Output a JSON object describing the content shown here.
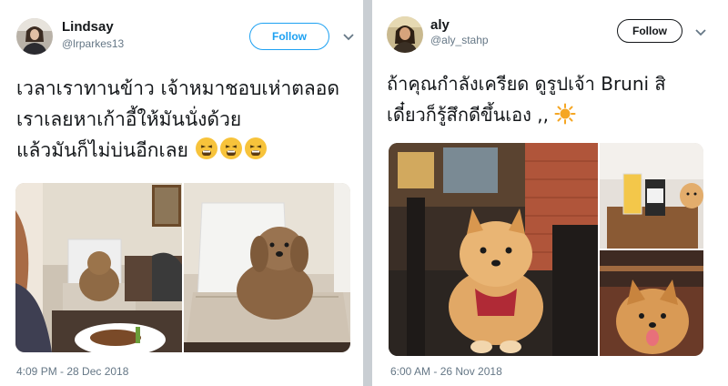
{
  "tweets": [
    {
      "author": {
        "name": "Lindsay",
        "handle": "@lrparkes13"
      },
      "follow_label": "Follow",
      "text_lines": [
        "เวลาเราทานข้าว เจ้าหมาชอบเห่าตลอด",
        "เราเลยหาเก้าอี้ให้มันนั่งด้วย",
        "แล้วมันก็ไม่บ่นอีกเลย"
      ],
      "emoji": [
        "tired-face",
        "tired-face",
        "tired-face"
      ],
      "timestamp": "4:09 PM - 28 Dec 2018"
    },
    {
      "author": {
        "name": "aly",
        "handle": "@aly_stahp"
      },
      "follow_label": "Follow",
      "text_lines": [
        "ถ้าคุณกำลังเครียด ดูรูปเจ้า Bruni สิ",
        "เดี๋ยวก็รู้สึกดีขึ้นเอง ,,"
      ],
      "emoji": [
        "sun"
      ],
      "timestamp": "6:00 AM - 26 Nov 2018"
    }
  ],
  "colors": {
    "twitter_blue": "#1da1f2",
    "text_primary": "#14171a",
    "text_secondary": "#657786",
    "divider": "#c9ced3"
  }
}
